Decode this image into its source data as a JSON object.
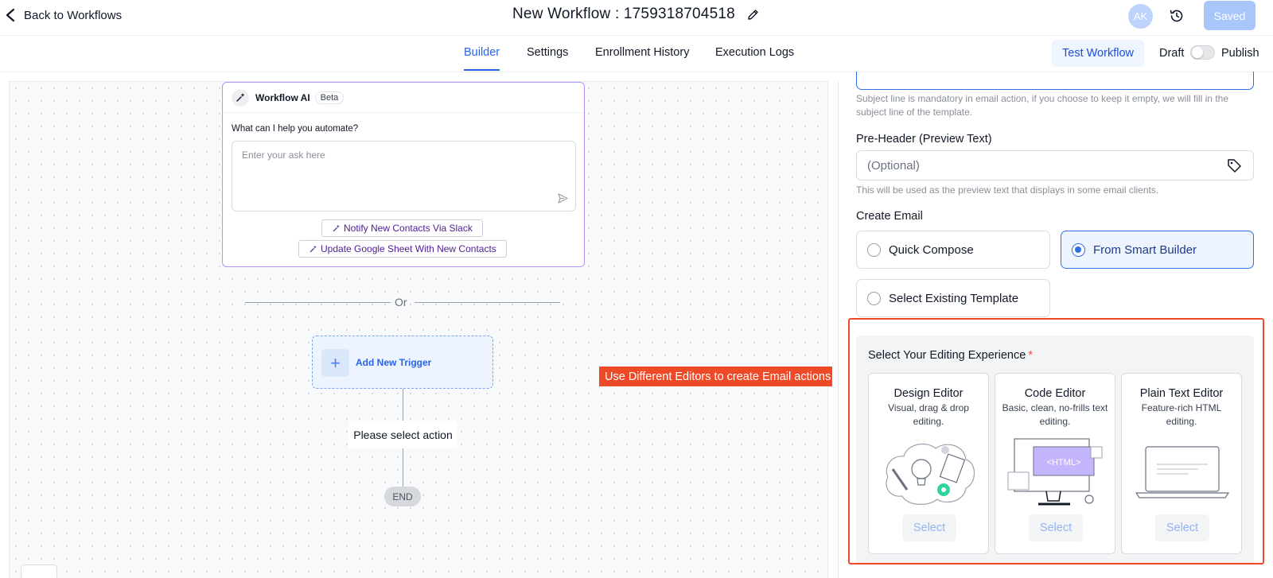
{
  "header": {
    "back_label": "Back to Workflows",
    "title": "New Workflow : 1759318704518",
    "avatar_initials": "AK",
    "saved_label": "Saved"
  },
  "tabs": [
    {
      "label": "Builder",
      "active": true
    },
    {
      "label": "Settings",
      "active": false
    },
    {
      "label": "Enrollment History",
      "active": false
    },
    {
      "label": "Execution Logs",
      "active": false
    }
  ],
  "actions": {
    "test_label": "Test Workflow",
    "draft_label": "Draft",
    "publish_label": "Publish",
    "publish_on": false
  },
  "ai_card": {
    "name": "Workflow AI",
    "badge": "Beta",
    "question": "What can I help you automate?",
    "placeholder": "Enter your ask here",
    "suggestions": [
      "Notify New Contacts Via Slack",
      "Update Google Sheet With New Contacts"
    ]
  },
  "canvas": {
    "or_label": "Or",
    "trigger_label": "Add New Trigger",
    "action_label": "Please select action",
    "end_label": "END",
    "callout": "Use Different Editors to create Email actions"
  },
  "panel": {
    "subject_help": "Subject line is mandatory in email action, if you choose to keep it empty, we will fill in the subject line of the template.",
    "preheader_label": "Pre-Header (Preview Text)",
    "preheader_placeholder": "(Optional)",
    "preheader_help": "This will be used as the preview text that displays in some email clients.",
    "create_email_label": "Create Email",
    "options": [
      {
        "label": "Quick Compose",
        "selected": false
      },
      {
        "label": "From Smart Builder",
        "selected": true
      },
      {
        "label": "Select Existing Template",
        "selected": false
      }
    ],
    "experience_title": "Select Your Editing Experience",
    "required_mark": "*",
    "editors": [
      {
        "name": "Design Editor",
        "desc": "Visual, drag & drop editing.",
        "select_label": "Select",
        "icon": "design-illustration"
      },
      {
        "name": "Code Editor",
        "desc": "Basic, clean, no-frills text editing.",
        "select_label": "Select",
        "icon": "code-illustration",
        "art_text": "<HTML>"
      },
      {
        "name": "Plain Text Editor",
        "desc": "Feature-rich HTML editing.",
        "select_label": "Select",
        "icon": "laptop-illustration"
      }
    ]
  },
  "colors": {
    "accent": "#2563eb",
    "callout": "#ee4a28",
    "ai_border": "#b692f6"
  }
}
